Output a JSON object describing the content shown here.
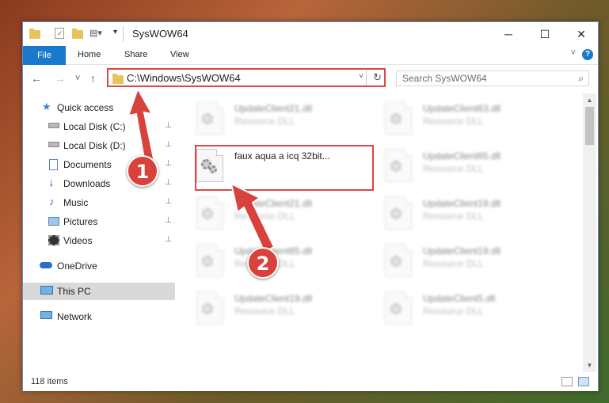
{
  "window": {
    "title": "SysWOW64",
    "controls": {
      "minimize": "─",
      "maximize": "☐",
      "close": "✕"
    }
  },
  "ribbon": {
    "tabs": [
      "File",
      "Home",
      "Share",
      "View"
    ],
    "help": "?"
  },
  "nav": {
    "back": "←",
    "forward": "→",
    "recent": "˅",
    "up": "↑"
  },
  "address": {
    "path": "C:\\Windows\\SysWOW64",
    "dropdown": "˅",
    "refresh": "↻"
  },
  "search": {
    "placeholder": "Search SysWOW64",
    "icon": "search-icon"
  },
  "sidebar": {
    "items": [
      {
        "label": "Quick access",
        "icon": "star-icon",
        "pinned": false
      },
      {
        "label": "Local Disk (C:)",
        "icon": "drive-icon",
        "pinned": true
      },
      {
        "label": "Local Disk (D:)",
        "icon": "drive-icon",
        "pinned": true
      },
      {
        "label": "Documents",
        "icon": "documents-icon",
        "pinned": true
      },
      {
        "label": "Downloads",
        "icon": "download-icon",
        "pinned": true
      },
      {
        "label": "Music",
        "icon": "music-icon",
        "pinned": true
      },
      {
        "label": "Pictures",
        "icon": "pictures-icon",
        "pinned": true
      },
      {
        "label": "Videos",
        "icon": "videos-icon",
        "pinned": true
      },
      {
        "label": "OneDrive",
        "icon": "cloud-icon",
        "pinned": false
      },
      {
        "label": "This PC",
        "icon": "computer-icon",
        "pinned": false
      },
      {
        "label": "Network",
        "icon": "network-icon",
        "pinned": false
      }
    ],
    "pin_glyph": "📌"
  },
  "files": [
    {
      "name": "UpdateClient21.dll",
      "type": "Resource DLL"
    },
    {
      "name": "UpdateClient63.dll",
      "type": "Resource DLL"
    },
    {
      "name": "faux aqua a icq 32bit...",
      "type": ""
    },
    {
      "name": "UpdateClient65.dll",
      "type": "Resource DLL"
    },
    {
      "name": "UpdateClient21.dll",
      "type": "Resource DLL"
    },
    {
      "name": "UpdateClient19.dll",
      "type": "Resource DLL"
    },
    {
      "name": "UpdateClient65.dll",
      "type": "Resource DLL"
    },
    {
      "name": "UpdateClient19.dll",
      "type": "Resource DLL"
    },
    {
      "name": "UpdateClient19.dll",
      "type": "Resource DLL"
    },
    {
      "name": "UpdateClient5.dll",
      "type": "Resource DLL"
    }
  ],
  "status": {
    "item_count": "118 items"
  },
  "callouts": {
    "one": "1",
    "two": "2"
  },
  "colors": {
    "accent": "#1979ca",
    "highlight": "#e04545",
    "callout": "#d8413c"
  }
}
